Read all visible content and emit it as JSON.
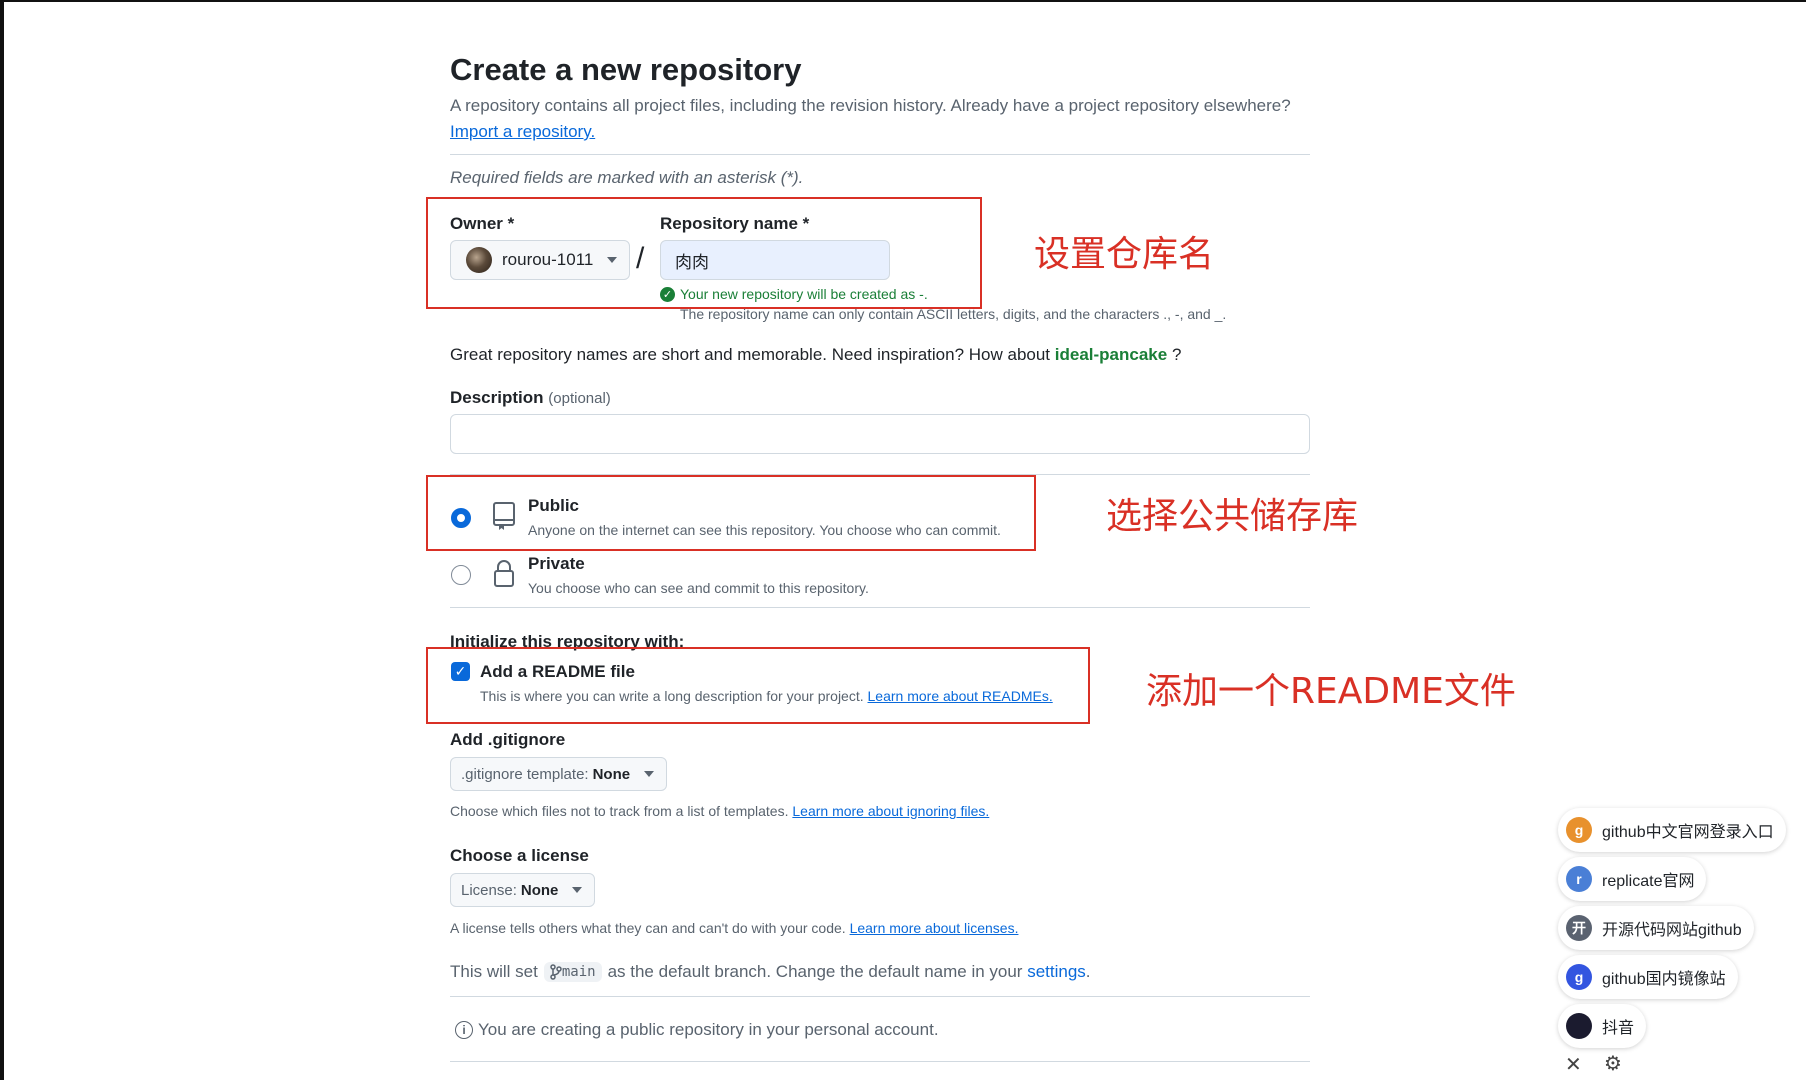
{
  "page": {
    "title": "Create a new repository",
    "intro": "A repository contains all project files, including the revision history. Already have a project repository elsewhere?",
    "import_link": "Import a repository.",
    "required_note": "Required fields are marked with an asterisk (*)."
  },
  "owner": {
    "label": "Owner *",
    "value": "rourou-1011"
  },
  "repo_name": {
    "label": "Repository name *",
    "value": "肉肉",
    "valid_msg": "Your new repository will be created as -.",
    "hint": "The repository name can only contain ASCII letters, digits, and the characters ., -, and _."
  },
  "inspiration": {
    "prefix": "Great repository names are short and memorable. Need inspiration? How about",
    "suggestion": "ideal-pancake",
    "suffix": " ?"
  },
  "description": {
    "label": "Description",
    "optional": "(optional)",
    "value": ""
  },
  "visibility": {
    "public_title": "Public",
    "public_desc": "Anyone on the internet can see this repository. You choose who can commit.",
    "private_title": "Private",
    "private_desc": "You choose who can see and commit to this repository.",
    "selected": "Public"
  },
  "init": {
    "label": "Initialize this repository with:",
    "readme_title": "Add a README file",
    "readme_checked": true,
    "readme_desc": "This is where you can write a long description for your project.",
    "readme_link": "Learn more about READMEs."
  },
  "gitignore": {
    "label": "Add .gitignore",
    "select_prefix": ".gitignore template:",
    "select_value": "None",
    "hint": "Choose which files not to track from a list of templates.",
    "hint_link": "Learn more about ignoring files."
  },
  "license": {
    "label": "Choose a license",
    "select_prefix": "License:",
    "select_value": "None",
    "hint": "A license tells others what they can and can't do with your code.",
    "hint_link": "Learn more about licenses."
  },
  "branch": {
    "prefix": "This will set",
    "name": "main",
    "middle": "as the default branch. Change the default name in your",
    "settings_link": "settings",
    "suffix": "."
  },
  "info": {
    "text": "You are creating a public repository in your personal account."
  },
  "annotations": {
    "repo_name": "设置仓库名",
    "public": "选择公共储存库",
    "readme": "添加一个README文件",
    "color": "#d93025"
  },
  "floating": {
    "items": [
      {
        "badge": "g",
        "label": "github中文官网登录入口",
        "color": "#e8912d"
      },
      {
        "badge": "r",
        "label": "replicate官网",
        "color": "#4a7fd6"
      },
      {
        "badge": "开",
        "label": "开源代码网站github",
        "color": "#5a6270"
      },
      {
        "badge": "g",
        "label": "github国内镜像站",
        "color": "#3355e0"
      },
      {
        "badge": "",
        "label": "抖音",
        "color": "#1b1b2f"
      }
    ],
    "close_icon": "close-icon",
    "settings_icon": "gear-icon"
  },
  "colors": {
    "accent": "#0969da",
    "success": "#1a7f37"
  }
}
